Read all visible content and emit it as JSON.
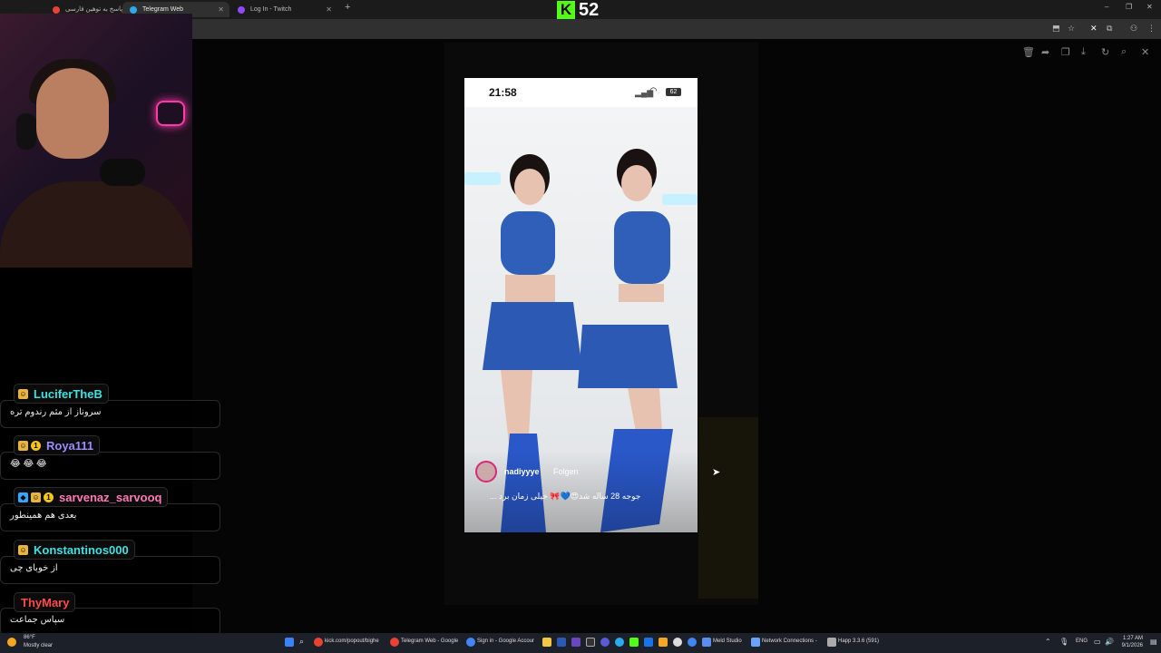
{
  "browser": {
    "tabs": [
      {
        "label": "پاسخ به توهین فارسی",
        "active": false
      },
      {
        "label": "Telegram Web",
        "active": true
      },
      {
        "label": "Log In - Twitch",
        "active": false
      }
    ],
    "new_tab": "+",
    "window_controls": {
      "minimize": "–",
      "restore": "❐",
      "close": "✕"
    }
  },
  "stream_overlay": {
    "logo_letter": "K",
    "viewer_count": "52",
    "brand_color": "#53fc18"
  },
  "phone": {
    "time": "21:58",
    "battery": "62",
    "username": "nadiyyye",
    "follow_label": "Folgen",
    "caption": "جوجه 28 ساله شد😍💙🎀 خیلی زمان برد ..."
  },
  "chat": [
    {
      "username": "LuciferTheB",
      "color": "#3ee1e1",
      "badges": [
        "sub"
      ],
      "text": "سروناز از مثم رندوم تره"
    },
    {
      "username": "Roya111",
      "color": "#9b8cff",
      "badges": [
        "sub",
        "vip"
      ],
      "text": "😂 😂 😂"
    },
    {
      "username": "sarvenaz_sarvooq",
      "color": "#ff7ab6",
      "badges": [
        "gem",
        "sub",
        "vip"
      ],
      "text": "بعدی هم همینطور"
    },
    {
      "username": "Konstantinos000",
      "color": "#3ee1e1",
      "badges": [
        "sub"
      ],
      "text": "از خوبای چی"
    },
    {
      "username": "ThyMary",
      "color": "#ff4a4a",
      "badges": [],
      "text": "سپاس جماعت"
    }
  ],
  "taskbar": {
    "weather_temp": "86°F",
    "weather_desc": "Mostly clear",
    "apps": [
      {
        "label": "kick.com/popout/bighe",
        "color": "#e94235"
      },
      {
        "label": "Telegram Web - Google",
        "color": "#e94235"
      },
      {
        "label": "Sign in - Google Accour",
        "color": "#4285f4"
      },
      {
        "label": "Meld Studio",
        "color": "#5b8def"
      },
      {
        "label": "Network Connections -",
        "color": "#6aa0ff"
      },
      {
        "label": "Happ 3.3.6 (591)",
        "color": "#aaaaaa"
      }
    ],
    "lang": "ENG",
    "time": "1:27 AM",
    "date": "9/1/2026"
  }
}
